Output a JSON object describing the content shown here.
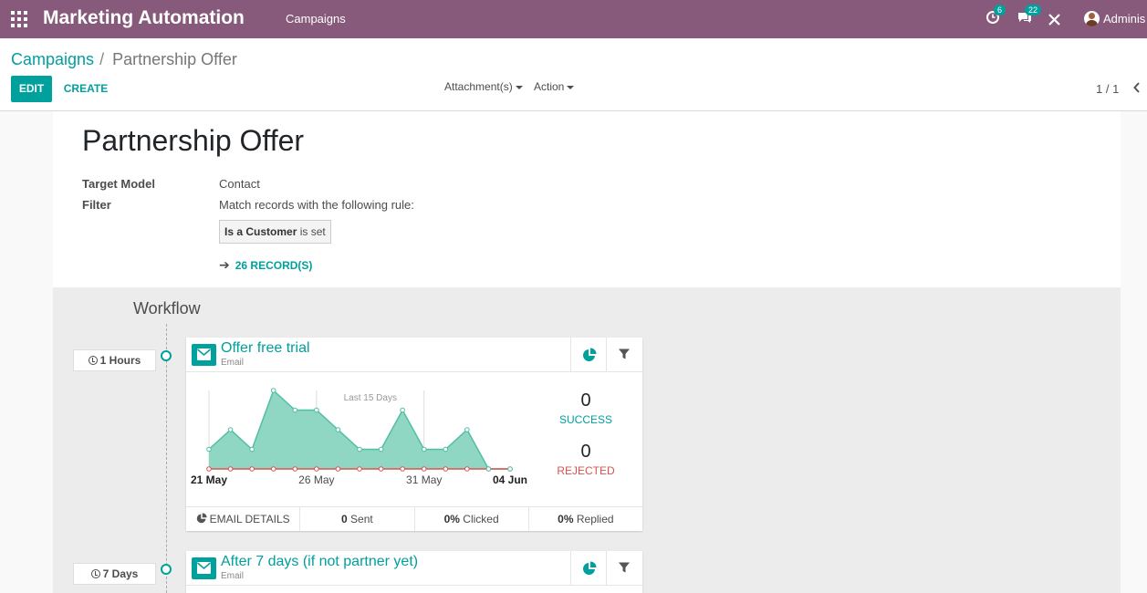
{
  "navbar": {
    "app_name": "Marketing Automation",
    "menu_campaigns": "Campaigns",
    "activity_count": "6",
    "message_count": "22",
    "user_name": "Adminis"
  },
  "control_panel": {
    "breadcrumb_parent": "Campaigns",
    "breadcrumb_separator": "/",
    "breadcrumb_current": "Partnership Offer",
    "edit_label": "EDIT",
    "create_label": "CREATE",
    "attachments_label": "Attachment(s)",
    "action_label": "Action",
    "pager": "1 / 1"
  },
  "form": {
    "title": "Partnership Offer",
    "target_model_label": "Target Model",
    "target_model_value": "Contact",
    "filter_label": "Filter",
    "filter_value": "Match records with the following rule:",
    "domain_field": "Is a Customer",
    "domain_operator": "is set",
    "records_link": "26 RECORD(S)"
  },
  "workflow": {
    "title": "Workflow",
    "activities": [
      {
        "delay": "1 Hours",
        "name": "Offer free trial",
        "type": "Email",
        "chart_caption": "Last 15 Days",
        "success_count": "0",
        "success_label": "SUCCESS",
        "rejected_count": "0",
        "rejected_label": "REJECTED",
        "details_label": "EMAIL DETAILS",
        "sent_value": "0",
        "sent_label": "Sent",
        "clicked_value": "0%",
        "clicked_label": "Clicked",
        "replied_value": "0%",
        "replied_label": "Replied"
      },
      {
        "delay": "7 Days",
        "name": "After 7 days (if not partner yet)",
        "type": "Email"
      }
    ]
  },
  "chart_data": {
    "type": "area",
    "title": "Last 15 Days",
    "x_tick_labels": [
      "21 May",
      "26 May",
      "31 May",
      "04 Jun"
    ],
    "series": [
      {
        "name": "",
        "color": "#8fd6c3",
        "values": [
          1,
          2,
          1,
          4,
          3,
          3,
          2,
          1,
          1,
          3,
          1,
          1,
          2,
          0,
          0
        ]
      },
      {
        "name": "",
        "color": "#d9534f",
        "values": [
          0,
          0,
          0,
          0,
          0,
          0,
          0,
          0,
          0,
          0,
          0,
          0,
          0,
          0,
          0
        ]
      }
    ],
    "ylim": [
      0,
      4
    ]
  },
  "colors": {
    "navbar": "#875a7b",
    "accent": "#00a09d",
    "success": "#00a09d",
    "rejected": "#d9534f"
  },
  "icons": [
    "apps-grid-icon",
    "activity-clock-icon",
    "chat-icon",
    "tools-icon",
    "clock-icon",
    "envelope-icon",
    "pie-chart-icon",
    "filter-icon",
    "arrow-right-icon",
    "chevron-left-icon"
  ]
}
